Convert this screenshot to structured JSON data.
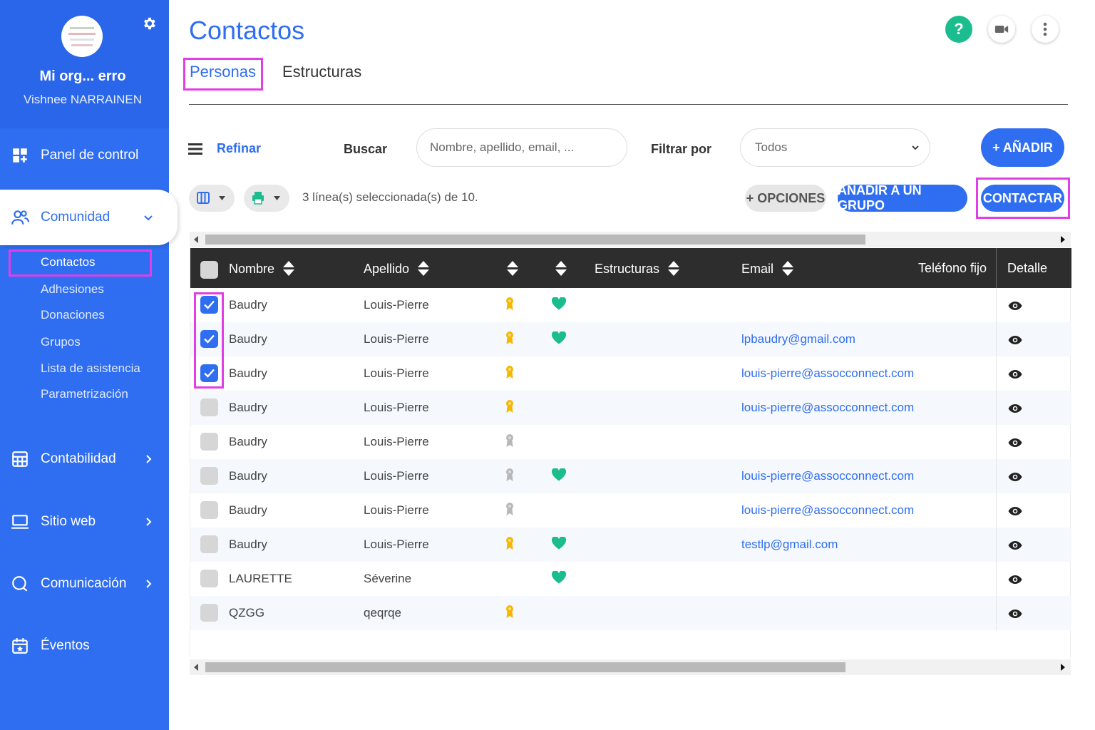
{
  "sidebar": {
    "org_name": "Mi org... erro",
    "user_name": "Vishnee NARRAINEN",
    "nav": {
      "panel": "Panel de control",
      "comunidad": "Comunidad",
      "contabilidad": "Contabilidad",
      "sitio_web": "Sitio web",
      "comunicacion": "Comunicación",
      "eventos": "Éventos"
    },
    "sub_items": [
      "Contactos",
      "Adhesiones",
      "Donaciones",
      "Grupos",
      "Lista de asistencia",
      "Parametrización"
    ]
  },
  "page": {
    "title": "Contactos",
    "tabs": [
      "Personas",
      "Estructuras"
    ]
  },
  "toolbar": {
    "refinar": "Refinar",
    "buscar_label": "Buscar",
    "search_placeholder": "Nombre, apellido, email, ...",
    "filtrar_label": "Filtrar por",
    "filter_value": "Todos",
    "add_button": "+ AÑADIR",
    "selection_text": "3 línea(s) seleccionada(s) de 10.",
    "opciones_button": "+ OPCIONES",
    "grupo_button": "AÑADIR A UN GRUPO",
    "contactar_button": "CONTACTAR"
  },
  "table": {
    "headers": {
      "nombre": "Nombre",
      "apellido": "Apellido",
      "estructuras": "Estructuras",
      "email": "Email",
      "telefono": "Teléfono fijo",
      "detalle": "Detalle"
    },
    "rows": [
      {
        "checked": true,
        "nombre": "Baudry",
        "apellido": "Louis-Pierre",
        "badge": "gold",
        "heart": true,
        "email": ""
      },
      {
        "checked": true,
        "nombre": "Baudry",
        "apellido": "Louis-Pierre",
        "badge": "gold",
        "heart": true,
        "email": "lpbaudry@gmail.com"
      },
      {
        "checked": true,
        "nombre": "Baudry",
        "apellido": "Louis-Pierre",
        "badge": "gold",
        "heart": false,
        "email": "louis-pierre@assocconnect.com"
      },
      {
        "checked": false,
        "nombre": "Baudry",
        "apellido": "Louis-Pierre",
        "badge": "gold",
        "heart": false,
        "email": "louis-pierre@assocconnect.com"
      },
      {
        "checked": false,
        "nombre": "Baudry",
        "apellido": "Louis-Pierre",
        "badge": "grey",
        "heart": false,
        "email": ""
      },
      {
        "checked": false,
        "nombre": "Baudry",
        "apellido": "Louis-Pierre",
        "badge": "grey",
        "heart": true,
        "email": "louis-pierre@assocconnect.com"
      },
      {
        "checked": false,
        "nombre": "Baudry",
        "apellido": "Louis-Pierre",
        "badge": "grey",
        "heart": false,
        "email": "louis-pierre@assocconnect.com"
      },
      {
        "checked": false,
        "nombre": "Baudry",
        "apellido": "Louis-Pierre",
        "badge": "gold",
        "heart": true,
        "email": "testlp@gmail.com"
      },
      {
        "checked": false,
        "nombre": "LAURETTE",
        "apellido": "Séverine",
        "badge": "none",
        "heart": true,
        "email": ""
      },
      {
        "checked": false,
        "nombre": "QZGG",
        "apellido": "qeqrqe",
        "badge": "gold",
        "heart": false,
        "email": ""
      }
    ]
  },
  "colors": {
    "accent": "#2f6ef0",
    "highlight": "#e13ee6",
    "heart": "#1bbd8e",
    "gold": "#f5b800",
    "grey_badge": "#b8b8b8"
  },
  "icons": {
    "sidebar": [
      "settings-gear-icon",
      "dashboard-icon",
      "community-icon",
      "accounting-icon",
      "website-icon",
      "communication-icon",
      "events-icon"
    ],
    "top": [
      "help-icon",
      "video-icon",
      "more-vertical-icon"
    ],
    "table": [
      "badge-ribbon-icon",
      "heart-icon",
      "eye-icon"
    ]
  }
}
